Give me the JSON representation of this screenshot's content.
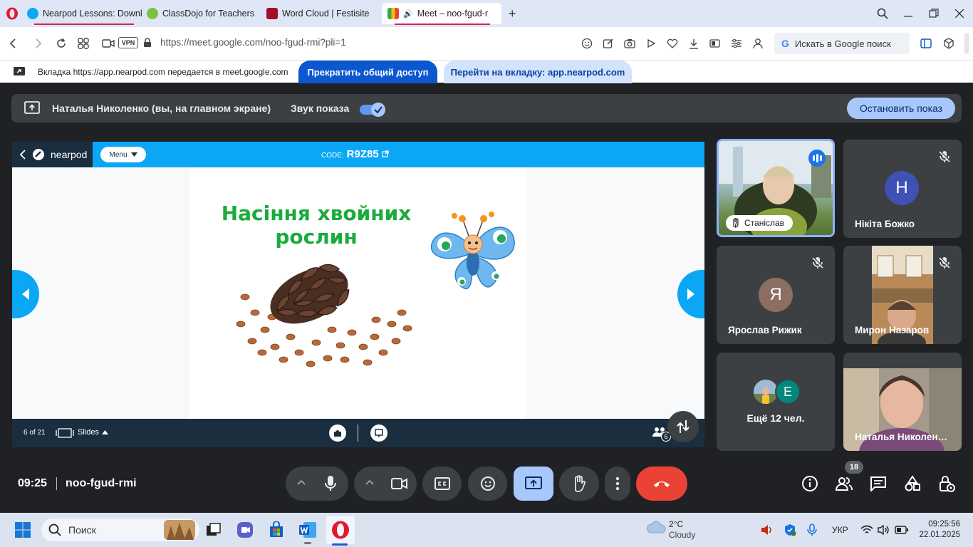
{
  "browser": {
    "tabs": [
      {
        "title": "Nearpod Lessons: Downlo",
        "active": false
      },
      {
        "title": "ClassDojo for Teachers",
        "active": false
      },
      {
        "title": "Word Cloud | Festisite",
        "active": false
      },
      {
        "title": "Meet – noo-fgud-r",
        "active": true
      }
    ],
    "url": "https://meet.google.com/noo-fgud-rmi?pli=1",
    "vpn_label": "VPN",
    "search_placeholder": "Искать в Google поиск"
  },
  "share_bar": {
    "text": "Вкладка https://app.nearpod.com передается в meet.google.com",
    "stop_label": "Прекратить общий доступ",
    "goto_label": "Перейти на вкладку: app.nearpod.com"
  },
  "presenting": {
    "name": "Наталья Николенко (вы, на главном экране)",
    "sound_label": "Звук показа",
    "sound_on": true,
    "stop_label": "Остановить показ"
  },
  "nearpod": {
    "logo": "nearpod",
    "menu_label": "Menu",
    "code_label": "CODE:",
    "code": "R9Z85",
    "slide_title_line1": "Насіння хвойних",
    "slide_title_line2": "рослин",
    "slide_count": "6 of 21",
    "slides_label": "Slides",
    "students_badge": "6"
  },
  "participants": [
    {
      "name": "Станіслав",
      "type": "video",
      "speaking": true
    },
    {
      "name": "Нікіта Божко",
      "initial": "Н",
      "color": "#3f51b5",
      "muted": true
    },
    {
      "name": "Ярослав Рижик",
      "initial": "Я",
      "color": "#8d6e63",
      "muted": true
    },
    {
      "name": "Мирон Назаров",
      "type": "video",
      "muted": true
    },
    {
      "name": "Ещё 12 чел.",
      "initial": "Е",
      "color": "#00897b"
    },
    {
      "name": "Наталья Николен…",
      "type": "video"
    }
  ],
  "meeting": {
    "time": "09:25",
    "code": "noo-fgud-rmi",
    "participants_count": "18"
  },
  "taskbar": {
    "search_label": "Поиск",
    "weather_temp": "2°C",
    "weather_desc": "Cloudy",
    "lang": "УКР",
    "time": "09:25:56",
    "date": "22.01.2025"
  },
  "colors": {
    "meet_bg": "#202124",
    "nearpod_blue": "#0ba7f5",
    "nearpod_dark": "#1a2e40",
    "hangup_red": "#ea4335",
    "present_active": "#a8c7fa",
    "slide_title_green": "#1bab3c"
  }
}
